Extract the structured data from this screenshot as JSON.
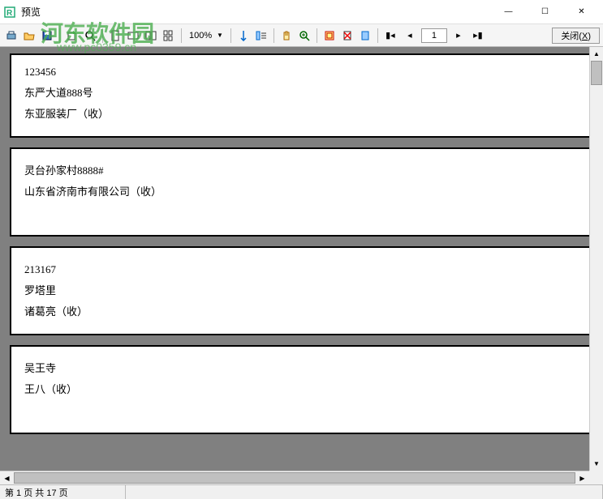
{
  "window": {
    "title": "预览",
    "minimize": "—",
    "maximize": "☐",
    "close": "✕"
  },
  "watermark": {
    "text": "河东软件园",
    "url": "www.pc0359.cn"
  },
  "toolbar": {
    "zoom_value": "100%",
    "page_input": "1",
    "close_label": "关闭(X)",
    "close_accel": "X"
  },
  "labels": [
    {
      "line1": "123456",
      "line2": "东严大道888号",
      "line3": "东亚服装厂（收）"
    },
    {
      "line1": "",
      "line2": "灵台孙家村8888#",
      "line3": "山东省济南市有限公司（收）"
    },
    {
      "line1": "213167",
      "line2": "罗塔里",
      "line3": "诸葛亮（收）"
    },
    {
      "line1": "",
      "line2": "吴王寺",
      "line3": "王八（收）"
    }
  ],
  "status": {
    "page_text": "第 1 页 共 17 页"
  }
}
